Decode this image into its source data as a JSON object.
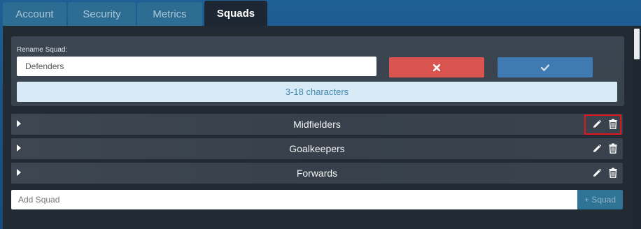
{
  "tabs": [
    {
      "label": "Account",
      "active": false
    },
    {
      "label": "Security",
      "active": false
    },
    {
      "label": "Metrics",
      "active": false
    },
    {
      "label": "Squads",
      "active": true
    }
  ],
  "rename": {
    "label": "Rename Squad:",
    "value": "Defenders",
    "hint": "3-18 characters",
    "cancel_icon": "times-icon",
    "confirm_icon": "check-icon"
  },
  "squads": [
    {
      "name": "Midfielders"
    },
    {
      "name": "Goalkeepers"
    },
    {
      "name": "Forwards"
    }
  ],
  "add": {
    "placeholder": "Add Squad",
    "button_label": "+ Squad"
  },
  "colors": {
    "accent": "#3f7ab2",
    "danger": "#d9534f",
    "highlight": "#e0161c"
  }
}
